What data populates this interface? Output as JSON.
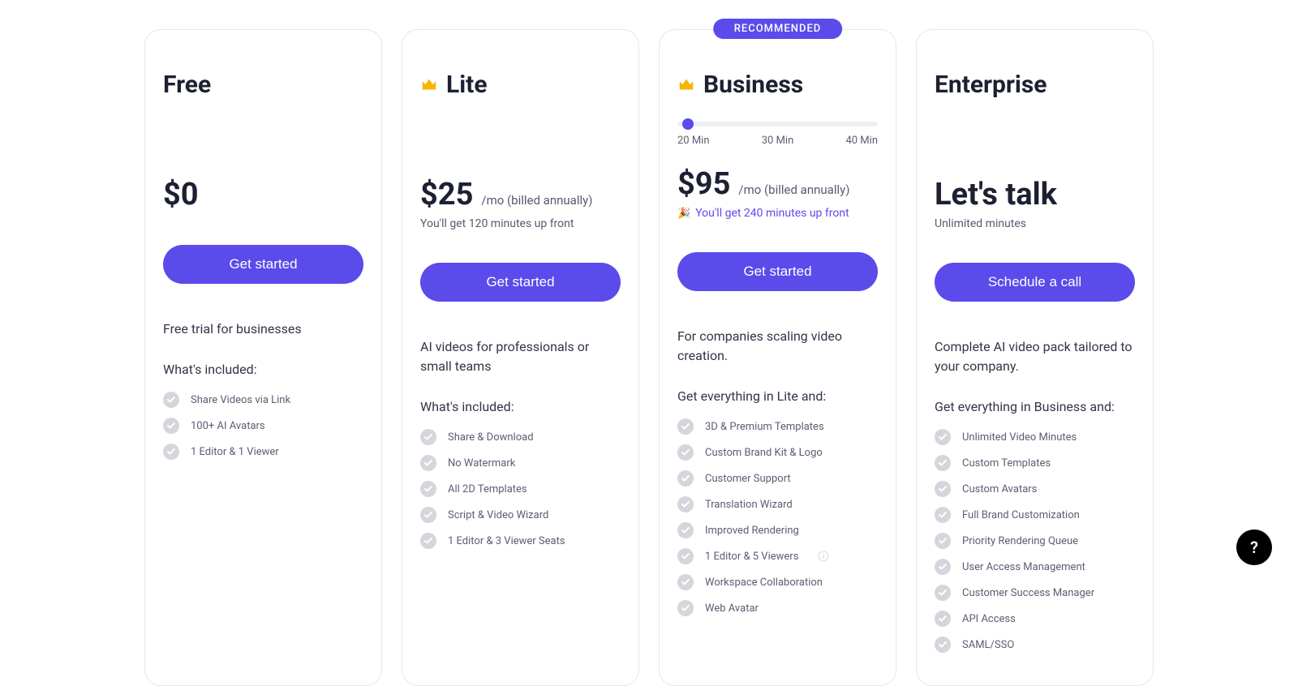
{
  "help_label": "?",
  "plans": [
    {
      "name": "Free",
      "price": "$0",
      "interval": "",
      "subline": "",
      "cta": "Get started",
      "desc": "Free trial for businesses",
      "included_label": "What's included:",
      "features": [
        {
          "text": "Share Videos via Link"
        },
        {
          "text": "100+ AI Avatars"
        },
        {
          "text": "1 Editor & 1 Viewer"
        }
      ]
    },
    {
      "name": "Lite",
      "price": "$25",
      "interval": "/mo (billed annually)",
      "subline": "You'll get 120 minutes up front",
      "cta": "Get started",
      "desc": "AI videos for professionals or small teams",
      "included_label": "What's included:",
      "features": [
        {
          "text": "Share & Download"
        },
        {
          "text": "No Watermark"
        },
        {
          "text": "All 2D Templates"
        },
        {
          "text": "Script & Video Wizard"
        },
        {
          "text": "1 Editor & 3 Viewer Seats"
        }
      ]
    },
    {
      "name": "Business",
      "badge": "RECOMMENDED",
      "slider": {
        "labels": [
          "20 Min",
          "30 Min",
          "40 Min"
        ]
      },
      "price": "$95",
      "interval": "/mo (billed annually)",
      "subline": "You'll get 240 minutes up front",
      "cta": "Get started",
      "desc": "For companies scaling video creation.",
      "included_label": "Get everything in Lite and:",
      "features": [
        {
          "text": "3D & Premium Templates"
        },
        {
          "text": "Custom Brand Kit & Logo"
        },
        {
          "text": "Customer Support"
        },
        {
          "text": "Translation Wizard"
        },
        {
          "text": "Improved Rendering"
        },
        {
          "text": "1 Editor & 5 Viewers",
          "info": true
        },
        {
          "text": "Workspace Collaboration"
        },
        {
          "text": "Web Avatar"
        }
      ]
    },
    {
      "name": "Enterprise",
      "price": "Let's talk",
      "interval": "",
      "subline": "Unlimited minutes",
      "cta": "Schedule a call",
      "desc": "Complete AI video pack tailored to your company.",
      "included_label": "Get everything in Business and:",
      "features": [
        {
          "text": "Unlimited Video Minutes"
        },
        {
          "text": "Custom Templates"
        },
        {
          "text": "Custom Avatars"
        },
        {
          "text": "Full Brand Customization"
        },
        {
          "text": "Priority Rendering Queue"
        },
        {
          "text": "User Access Management"
        },
        {
          "text": "Customer Success Manager"
        },
        {
          "text": "API Access"
        },
        {
          "text": "SAML/SSO"
        }
      ]
    }
  ]
}
